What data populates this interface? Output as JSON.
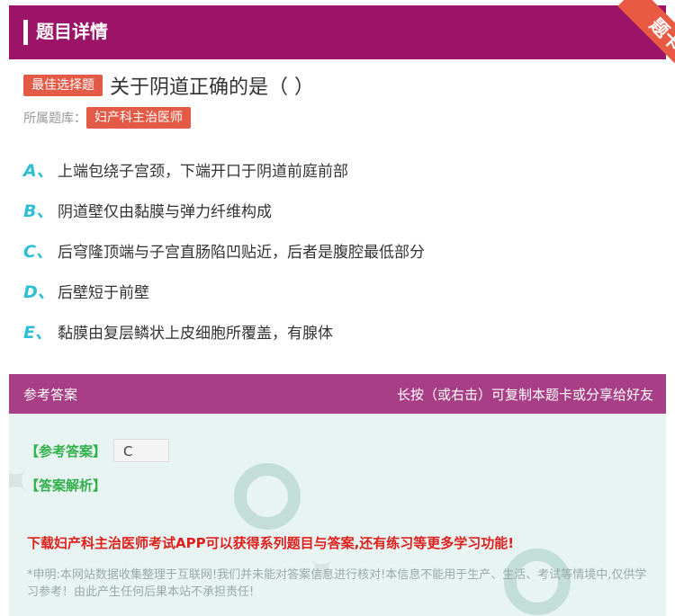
{
  "header": {
    "title": "题目详情",
    "ribbon": "题卡"
  },
  "question": {
    "badge": "最佳选择题",
    "text": "关于阴道正确的是（ ）",
    "bank_label": "所属题库：",
    "bank_name": "妇产科主治医师"
  },
  "options": [
    {
      "letter": "A、",
      "text": "上端包绕子宫颈，下端开口于阴道前庭前部"
    },
    {
      "letter": "B、",
      "text": "阴道壁仅由黏膜与弹力纤维构成"
    },
    {
      "letter": "C、",
      "text": "后穹隆顶端与子宫直肠陷凹贴近，后者是腹腔最低部分"
    },
    {
      "letter": "D、",
      "text": "后壁短于前壁"
    },
    {
      "letter": "E、",
      "text": "黏膜由复层鳞状上皮细胞所覆盖，有腺体"
    }
  ],
  "answer_section": {
    "title": "参考答案",
    "hint": "长按（或右击）可复制本题卡或分享给好友",
    "answer_label": "【参考答案】",
    "answer_value": "C",
    "analysis_label": "【答案解析】",
    "promo": "下载妇产科主治医师考试APP可以获得系列题目与答案,还有练习等更多学习功能!",
    "disclaimer": "*申明:本网站数据收集整理于互联网!我们并未能对答案信息进行核对!本信息不能用于生产、生活、考试等情境中,仅供学习参考！由此产生任何后果本站不承担责任!"
  },
  "colors": {
    "header": "#9c1467",
    "answer_header": "#a83e86",
    "badge": "#e35a46",
    "option_letter": "#2ebfd4",
    "answer_bg": "#e7f4f1"
  }
}
